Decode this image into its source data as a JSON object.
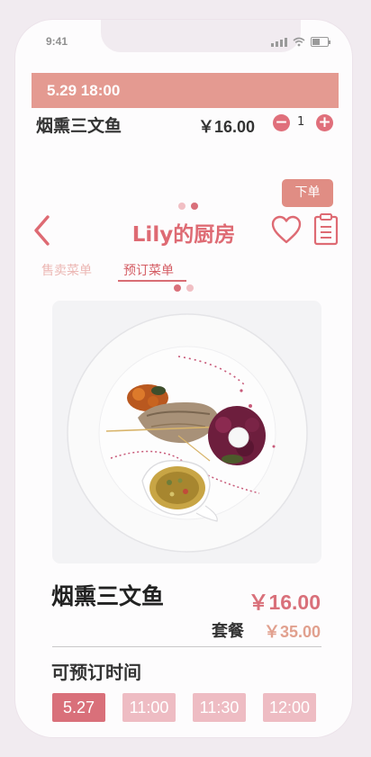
{
  "status_bar": {
    "time": "9:41"
  },
  "order": {
    "datetime": "5.29 18:00",
    "item_name": "烟熏三文鱼",
    "item_price": "￥16.00",
    "quantity": "1",
    "minus_symbol": "−",
    "plus_symbol": "+"
  },
  "header": {
    "submit_label": "下单",
    "title": "Lily的厨房",
    "tabs": [
      {
        "label": "售卖菜单"
      },
      {
        "label": "预订菜单"
      }
    ]
  },
  "dish": {
    "name": "烟熏三文鱼",
    "price": "￥16.00",
    "set_label": "套餐",
    "set_price": "￥35.00"
  },
  "availability": {
    "label": "可预订时间",
    "slots": [
      {
        "label": "5.27"
      },
      {
        "label": "11:00"
      },
      {
        "label": "11:30"
      },
      {
        "label": "12:00"
      }
    ]
  },
  "colors": {
    "accent": "#de6a73",
    "order_bar": "#e49a91",
    "slot_active": "#d9707a",
    "slot_inactive": "#eebcc3",
    "dot_dark": "#d9707a",
    "dot_light": "#f1bfc4"
  },
  "icons": [
    "back-chevron-icon",
    "heart-icon",
    "clipboard-icon",
    "signal-icon",
    "wifi-icon",
    "battery-icon"
  ]
}
